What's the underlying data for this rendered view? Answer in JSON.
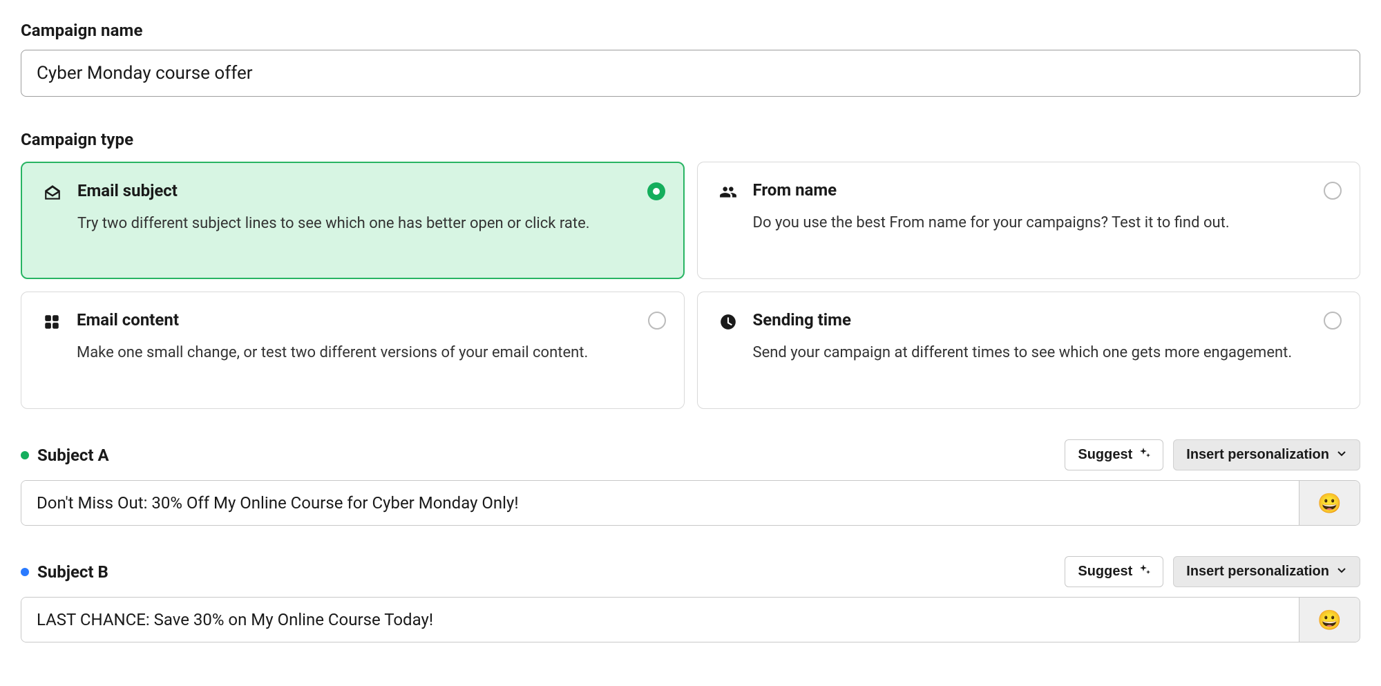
{
  "campaignName": {
    "label": "Campaign name",
    "value": "Cyber Monday course offer"
  },
  "campaignType": {
    "label": "Campaign type",
    "options": [
      {
        "key": "email-subject",
        "title": "Email subject",
        "desc": "Try two different subject lines to see which one has better open or click rate.",
        "selected": true,
        "iconName": "envelope-open-icon"
      },
      {
        "key": "from-name",
        "title": "From name",
        "desc": "Do you use the best From name for your campaigns? Test it to find out.",
        "selected": false,
        "iconName": "people-icon"
      },
      {
        "key": "email-content",
        "title": "Email content",
        "desc": "Make one small change, or test two different versions of your email content.",
        "selected": false,
        "iconName": "grid-icon"
      },
      {
        "key": "sending-time",
        "title": "Sending time",
        "desc": "Send your campaign at different times to see which one gets more engagement.",
        "selected": false,
        "iconName": "clock-icon"
      }
    ]
  },
  "subjects": {
    "a": {
      "label": "Subject A",
      "value": "Don't Miss Out: 30% Off My Online Course for Cyber Monday Only!"
    },
    "b": {
      "label": "Subject B",
      "value": "LAST CHANCE: Save 30% on My Online Course Today!"
    },
    "suggestLabel": "Suggest",
    "personalizationLabel": "Insert personalization",
    "emoji": "😀"
  }
}
